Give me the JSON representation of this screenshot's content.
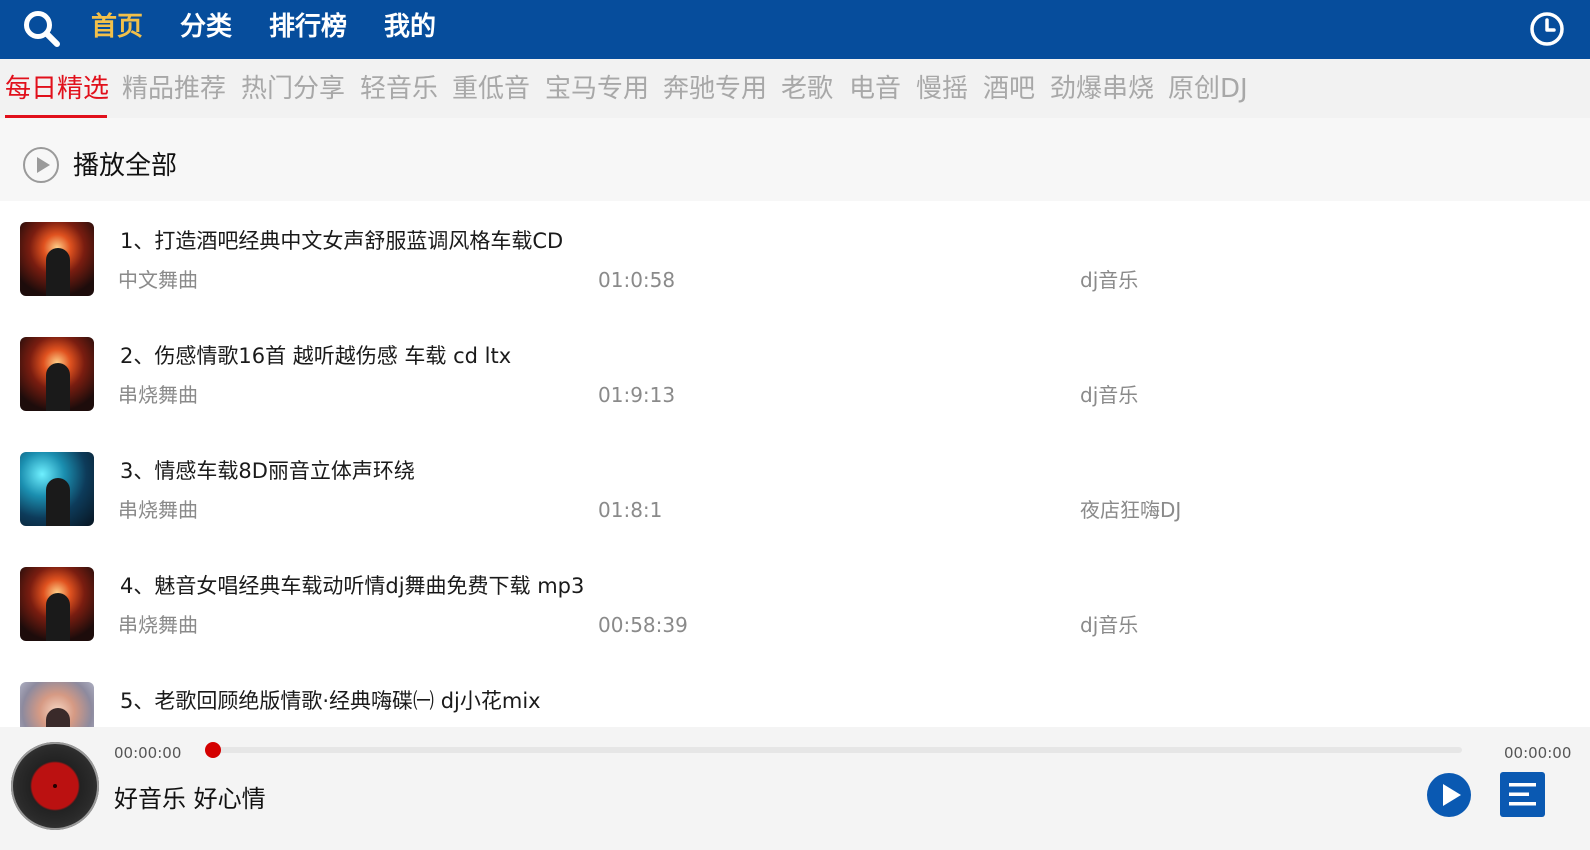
{
  "top_nav": {
    "tabs": [
      {
        "label": "首页",
        "active": true
      },
      {
        "label": "分类",
        "active": false
      },
      {
        "label": "排行榜",
        "active": false
      },
      {
        "label": "我的",
        "active": false
      }
    ],
    "search_icon": "search-icon",
    "history_icon": "clock-icon"
  },
  "categories": {
    "items": [
      "每日精选",
      "精品推荐",
      "热门分享",
      "轻音乐",
      "重低音",
      "宝马专用",
      "奔驰专用",
      "老歌",
      "电音",
      "慢摇",
      "酒吧",
      "劲爆串烧",
      "原创DJ"
    ],
    "selected": "每日精选"
  },
  "play_all": {
    "label": "播放全部",
    "icon": "play-circle-icon"
  },
  "songs": [
    {
      "title": "1、打造酒吧经典中文女声舒服蓝调风格车载CD",
      "genre": "中文舞曲",
      "duration": "01:0:58",
      "source": "dj音乐"
    },
    {
      "title": "2、伤感情歌16首 越听越伤感 车载 cd ltx",
      "genre": "串烧舞曲",
      "duration": "01:9:13",
      "source": "dj音乐"
    },
    {
      "title": "3、情感车载8D丽音立体声环绕",
      "genre": "串烧舞曲",
      "duration": "01:8:1",
      "source": "夜店狂嗨DJ"
    },
    {
      "title": "4、魅音女唱经典车载动听情dj舞曲免费下载 mp3",
      "genre": "串烧舞曲",
      "duration": "00:58:39",
      "source": "dj音乐"
    },
    {
      "title": "5、老歌回顾绝版情歌·经典嗨碟㈠ dj小花mix",
      "genre": "",
      "duration": "",
      "source": ""
    }
  ],
  "player": {
    "current_time": "00:00:00",
    "total_time": "00:00:00",
    "progress": 0.0,
    "slogan": "好音乐 好心情",
    "play_icon": "play-icon",
    "playlist_icon": "playlist-icon"
  },
  "colors": {
    "top_bar": "#064d9c",
    "active_tab": "#f2c04a",
    "active_category": "#e1101b",
    "progress": "#d40000",
    "button_blue": "#0a59b2"
  }
}
